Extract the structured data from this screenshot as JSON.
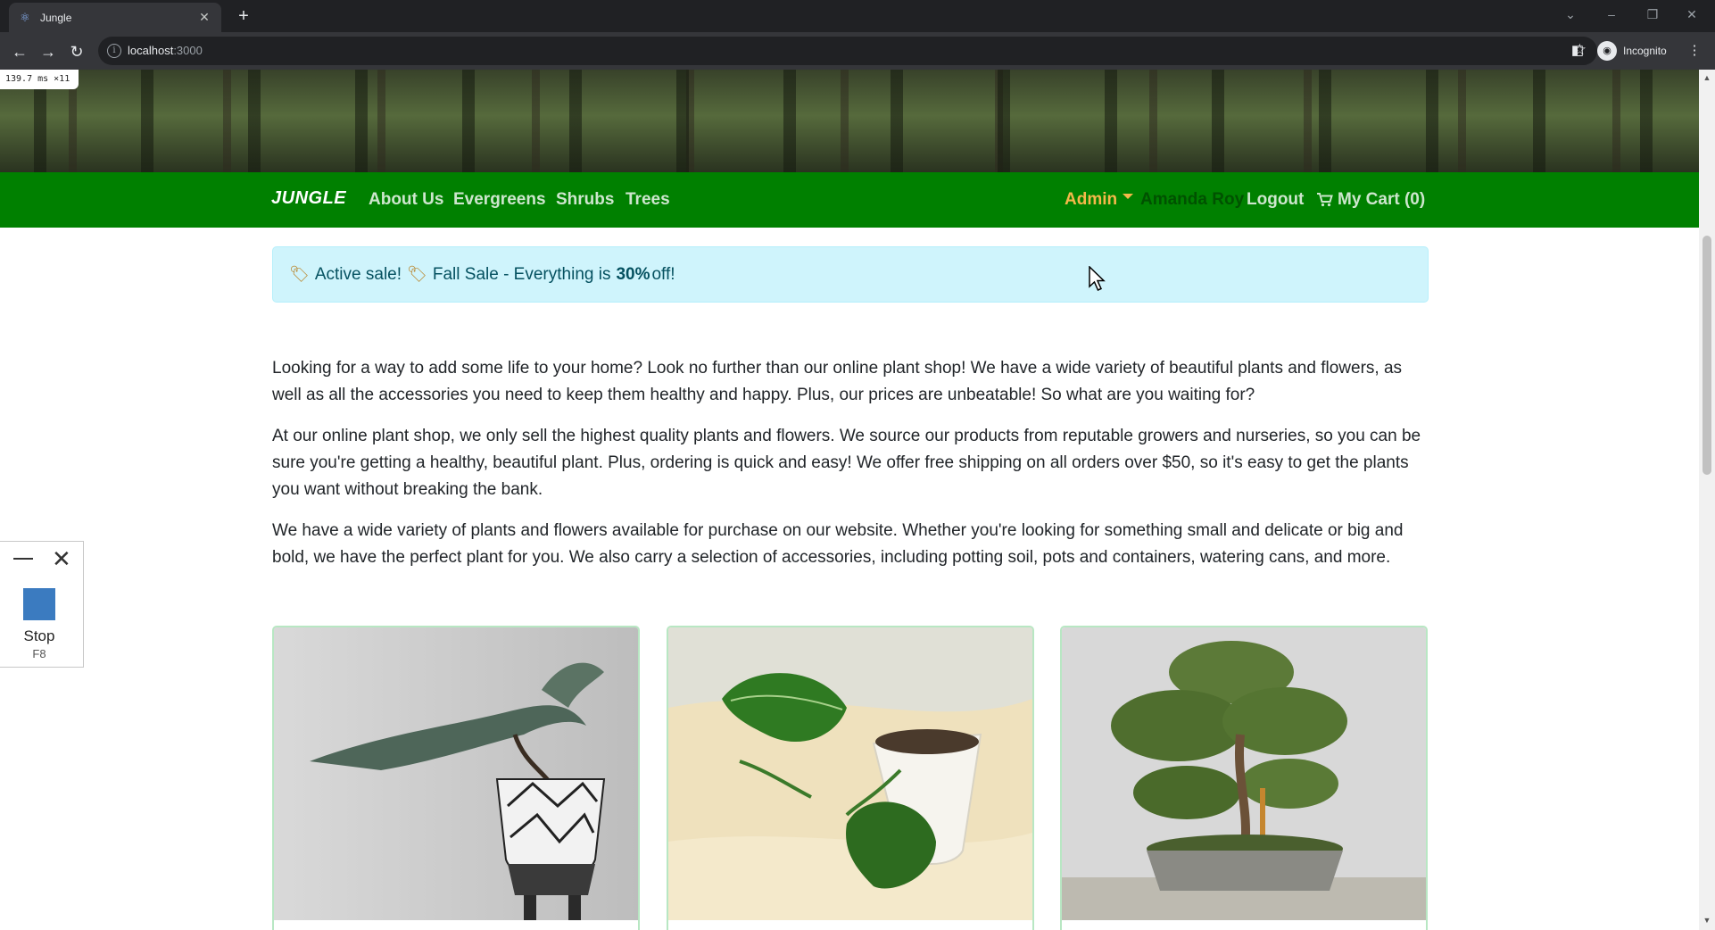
{
  "browser": {
    "tab_title": "Jungle",
    "tab_icon": "react-icon",
    "url_host": "localhost",
    "url_port": ":3000",
    "profile_label": "Incognito",
    "perf_overlay": "139.7 ms ×11"
  },
  "nav": {
    "brand": "JUNGLE",
    "links": [
      "About Us",
      "Evergreens",
      "Shrubs",
      "Trees"
    ],
    "admin_label": "Admin",
    "user_name": "Amanda Roy",
    "logout_label": "Logout",
    "cart_label": "My Cart (0)"
  },
  "sale": {
    "prefix": "Active sale!",
    "text": "Fall Sale - Everything is",
    "amount": "30%",
    "suffix": "off!"
  },
  "intro": {
    "paragraphs": [
      "Looking for a way to add some life to your home? Look no further than our online plant shop! We have a wide variety of beautiful plants and flowers, as well as all the accessories you need to keep them healthy and happy. Plus, our prices are unbeatable! So what are you waiting for?",
      "At our online plant shop, we only sell the highest quality plants and flowers. We source our products from reputable growers and nurseries, so you can be sure you're getting a healthy, beautiful plant. Plus, ordering is quick and easy! We offer free shipping on all orders over $50, so it's easy to get the plants you want without breaking the bank.",
      "We have a wide variety of plants and flowers available for purchase on our website. Whether you're looking for something small and delicate or big and bold, we have the perfect plant for you. We also carry a selection of accessories, including potting soil, pots and containers, watering cans, and more."
    ]
  },
  "recorder": {
    "stop_label": "Stop",
    "stop_key": "F8"
  },
  "colors": {
    "navbar": "#008000",
    "admin": "#f5b84a",
    "alert_bg": "#cff4fc",
    "card_border": "#b8e7c3"
  }
}
